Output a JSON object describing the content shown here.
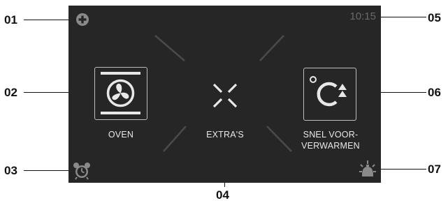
{
  "callouts": [
    "01",
    "02",
    "03",
    "04",
    "05",
    "06",
    "07"
  ],
  "screen": {
    "clock": "10:15",
    "functions": [
      {
        "label": "OVEN",
        "icon": "fan-icon"
      },
      {
        "label": "EXTRA'S",
        "icon": "extras-cross-icon"
      },
      {
        "label": "SNEL VOOR-",
        "label_line2": "VERWARMEN",
        "icon": "rapid-preheat-icon"
      }
    ],
    "corner_icons": {
      "top_left": "add-plus-icon",
      "bottom_left": "alarm-clock-icon",
      "bottom_right": "light-bulb-icon"
    }
  },
  "colors": {
    "screen_bg": "#262626",
    "label": "#e8e8e8",
    "clock": "#6a6a6a",
    "accent_icon": "#8a8a8a"
  }
}
